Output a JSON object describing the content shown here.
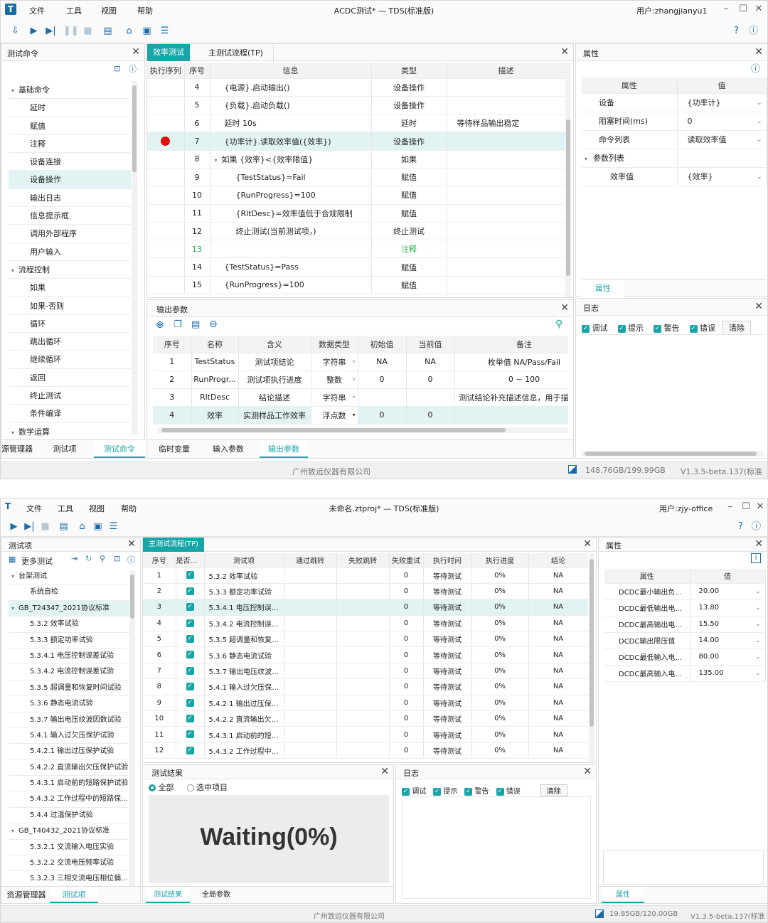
{
  "w1": {
    "title": "ACDC测试* — TDS(标准版)",
    "menu": [
      "文件",
      "工具",
      "视图",
      "帮助"
    ],
    "user": "用户:zhangjianyu1",
    "left": {
      "title": "测试命令",
      "tree": [
        {
          "label": "基础命令",
          "level": 0,
          "expanded": true
        },
        {
          "label": "延时",
          "level": 1
        },
        {
          "label": "赋值",
          "level": 1
        },
        {
          "label": "注释",
          "level": 1
        },
        {
          "label": "设备连接",
          "level": 1
        },
        {
          "label": "设备操作",
          "level": 1,
          "selected": true
        },
        {
          "label": "输出日志",
          "level": 1
        },
        {
          "label": "信息提示框",
          "level": 1
        },
        {
          "label": "调用外部程序",
          "level": 1
        },
        {
          "label": "用户输入",
          "level": 1
        },
        {
          "label": "流程控制",
          "level": 0,
          "expanded": true
        },
        {
          "label": "如果",
          "level": 1
        },
        {
          "label": "如果-否则",
          "level": 1
        },
        {
          "label": "循环",
          "level": 1
        },
        {
          "label": "跳出循环",
          "level": 1
        },
        {
          "label": "继续循环",
          "level": 1
        },
        {
          "label": "返回",
          "level": 1
        },
        {
          "label": "终止测试",
          "level": 1
        },
        {
          "label": "条件编译",
          "level": 1
        },
        {
          "label": "数学运算",
          "level": 0,
          "expanded": true
        }
      ],
      "bottom_tabs": [
        "源管理器",
        "测试项",
        "测试命令"
      ]
    },
    "center": {
      "tabs": [
        "效率测试",
        "主测试流程(TP)"
      ],
      "columns": [
        "执行序列",
        "序号",
        "信息",
        "类型",
        "描述"
      ],
      "rows": [
        {
          "n": "4",
          "info": "{电源}.启动输出()",
          "type": "设备操作",
          "desc": ""
        },
        {
          "n": "5",
          "info": "{负载}.启动负载()",
          "type": "设备操作",
          "desc": ""
        },
        {
          "n": "6",
          "info": "延时 10s",
          "type": "延时",
          "desc": "等待样品输出稳定"
        },
        {
          "n": "7",
          "info": "{功率计}.读取效率值({效率})",
          "type": "设备操作",
          "desc": "",
          "bp": true,
          "sel": true
        },
        {
          "n": "8",
          "info": "如果 {效率}<{效率限值}",
          "type": "如果",
          "desc": "",
          "fold": true
        },
        {
          "n": "9",
          "info": "{TestStatus}=Fail",
          "type": "赋值",
          "desc": "",
          "ind": true
        },
        {
          "n": "10",
          "info": "{RunProgress}=100",
          "type": "赋值",
          "desc": "",
          "ind": true
        },
        {
          "n": "11",
          "info": "{RltDesc}=效率值低于合规限制",
          "type": "赋值",
          "desc": "",
          "ind": true
        },
        {
          "n": "12",
          "info": "终止测试(当前测试项，)",
          "type": "终止测试",
          "desc": "",
          "ind": true
        },
        {
          "n": "13",
          "info": "",
          "type": "注释",
          "desc": "",
          "green": true
        },
        {
          "n": "14",
          "info": "{TestStatus}=Pass",
          "type": "赋值",
          "desc": ""
        },
        {
          "n": "15",
          "info": "{RunProgress}=100",
          "type": "赋值",
          "desc": ""
        }
      ]
    },
    "output": {
      "title": "输出参数",
      "columns": [
        "序号",
        "名称",
        "含义",
        "数据类型",
        "初始值",
        "当前值",
        "备注"
      ],
      "rows": [
        {
          "n": "1",
          "name": "TestStatus",
          "mean": "测试项结论",
          "dtype": "字符串",
          "init": "NA",
          "cur": "NA",
          "note": "枚举值 NA/Pass/Fail"
        },
        {
          "n": "2",
          "name": "RunProgr...",
          "mean": "测试项执行进度",
          "dtype": "整数",
          "init": "0",
          "cur": "0",
          "note": "0 ~ 100"
        },
        {
          "n": "3",
          "name": "RltDesc",
          "mean": "结论描述",
          "dtype": "字符串",
          "init": "",
          "cur": "",
          "note": "测试结论补充描述信息，用于描"
        },
        {
          "n": "4",
          "name": "效率",
          "mean": "实测样品工作效率",
          "dtype": "浮点数",
          "init": "0",
          "cur": "0",
          "note": "",
          "sel": true
        }
      ],
      "bottom_tabs": [
        "临时变量",
        "输入参数",
        "输出参数"
      ]
    },
    "props": {
      "title": "属性",
      "columns": [
        "属性",
        "值"
      ],
      "rows": [
        {
          "k": "设备",
          "v": "{功率计}",
          "dd": true
        },
        {
          "k": "阻塞时间(ms)",
          "v": "0",
          "dd": true
        },
        {
          "k": "命令列表",
          "v": "读取效率值",
          "dd": true
        },
        {
          "k": "参数列表",
          "v": "",
          "group": true
        },
        {
          "k": "效率值",
          "v": "{效率}",
          "dd": true,
          "sub": true
        }
      ],
      "tab": "属性"
    },
    "log": {
      "title": "日志",
      "filters": [
        "调试",
        "提示",
        "警告",
        "错误"
      ],
      "clear": "清除"
    },
    "status": {
      "company": "广州致远仪器有限公司",
      "disk": "148.76GB/199.99GB",
      "version": "V1.3.5-beta.137(标准版)"
    }
  },
  "w2": {
    "title": "未命名.ztproj* — TDS(标准版)",
    "menu": [
      "文件",
      "工具",
      "视图",
      "帮助"
    ],
    "user": "用户:zjy-office",
    "left": {
      "title": "测试项",
      "more": "更多测试",
      "tree": [
        {
          "label": "台架测试",
          "level": 0
        },
        {
          "label": "系统自检",
          "level": 1
        },
        {
          "label": "GB_T24347_2021协议标准",
          "level": 0,
          "selected": true
        },
        {
          "label": "5.3.2 效率试验",
          "level": 1
        },
        {
          "label": "5.3.3 额定功率试验",
          "level": 1
        },
        {
          "label": "5.3.4.1 电压控制误差试验",
          "level": 1
        },
        {
          "label": "5.3.4.2 电流控制误差试验",
          "level": 1
        },
        {
          "label": "5.3.5 超调量和恢复时间试验",
          "level": 1
        },
        {
          "label": "5.3.6 静态电流试验",
          "level": 1
        },
        {
          "label": "5.3.7 输出电压纹波因数试验",
          "level": 1
        },
        {
          "label": "5.4.1 输入过欠压保护试验",
          "level": 1
        },
        {
          "label": "5.4.2.1 输出过压保护试验",
          "level": 1
        },
        {
          "label": "5.4.2.2 直流输出欠压保护试验",
          "level": 1
        },
        {
          "label": "5.4.3.1 启动前的短路保护试验",
          "level": 1
        },
        {
          "label": "5.4.3.2 工作过程中的短路保...",
          "level": 1
        },
        {
          "label": "5.4.4 过温保护试验",
          "level": 1
        },
        {
          "label": "GB_T40432_2021协议标准",
          "level": 0
        },
        {
          "label": "5.3.2.1 交流输入电压实验",
          "level": 1
        },
        {
          "label": "5.3.2.2 交流电压频率试验",
          "level": 1
        },
        {
          "label": "5.3.2.3 三相交流电压相位偏...",
          "level": 1
        }
      ],
      "bottom_tabs": [
        "资源管理器",
        "测试项"
      ]
    },
    "center": {
      "tab": "主测试流程(TP)",
      "columns": [
        "序号",
        "是否执行",
        "测试项",
        "通过跳转",
        "失败跳转",
        "失败重试",
        "执行时间",
        "执行进度",
        "结论"
      ],
      "rows": [
        {
          "n": "1",
          "item": "5.3.2 效率试验"
        },
        {
          "n": "2",
          "item": "5.3.3 额定功率试验"
        },
        {
          "n": "3",
          "item": "5.3.4.1 电压控制误差...",
          "sel": true
        },
        {
          "n": "4",
          "item": "5.3.4.2 电流控制误差..."
        },
        {
          "n": "5",
          "item": "5.3.5 超调量和恢复时..."
        },
        {
          "n": "6",
          "item": "5.3.6 静态电流试验"
        },
        {
          "n": "7",
          "item": "5.3.7 输出电压纹波因..."
        },
        {
          "n": "8",
          "item": "5.4.1 输入过欠压保护..."
        },
        {
          "n": "9",
          "item": "5.4.2.1 输出过压保护..."
        },
        {
          "n": "10",
          "item": "5.4.2.2 直流输出欠压..."
        },
        {
          "n": "11",
          "item": "5.4.3.1 启动前的短路..."
        },
        {
          "n": "12",
          "item": "5.4.3.2 工作过程中的..."
        }
      ],
      "retry": "0",
      "time": "等待测试",
      "progress": "0%",
      "result": "NA"
    },
    "results": {
      "title": "测试结果",
      "radio_all": "全部",
      "radio_sel": "选中项目",
      "big": "Waiting(0%)",
      "bottom_tabs": [
        "测试结果",
        "全局参数"
      ]
    },
    "log": {
      "title": "日志",
      "filters": [
        "调试",
        "提示",
        "警告",
        "错误"
      ],
      "clear": "清除"
    },
    "props": {
      "title": "属性",
      "columns": [
        "属性",
        "值"
      ],
      "rows": [
        {
          "k": "DCDC最小输出负...",
          "v": "20.00"
        },
        {
          "k": "DCDC最低输出电...",
          "v": "13.80"
        },
        {
          "k": "DCDC最高输出电...",
          "v": "15.50"
        },
        {
          "k": "DCDC输出限压值",
          "v": "14.00"
        },
        {
          "k": "DCDC最低输入电...",
          "v": "80.00"
        },
        {
          "k": "DCDC最高输入电...",
          "v": "135.00"
        }
      ],
      "tab": "属性"
    },
    "status": {
      "company": "广州致远仪器有限公司",
      "disk": "19.85GB/120.00GB",
      "version": "V1.3.5-beta.137(标准版)"
    }
  }
}
